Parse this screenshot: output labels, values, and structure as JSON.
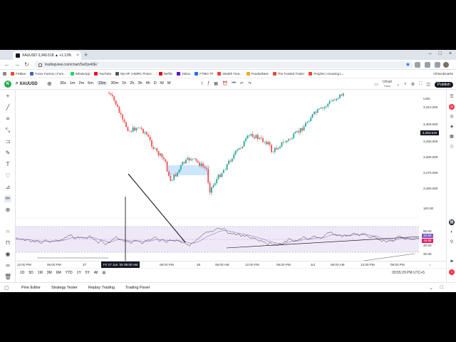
{
  "browser": {
    "tab_title": "XAUUSD 3,340.518 ▲ +1.13%",
    "url": "tradingview.com/chart/SeDjo40E/",
    "bookmarks": [
      {
        "label": "FXBlue",
        "color": "#e8463a"
      },
      {
        "label": "Forex Factory | Fore...",
        "color": "#3a66c4"
      },
      {
        "label": "WhatsApp",
        "color": "#25d366"
      },
      {
        "label": "YouTube",
        "color": "#ff0000"
      },
      {
        "label": "My HP | HMRC Protec...",
        "color": "#555"
      },
      {
        "label": "Netflix",
        "color": "#e50914"
      },
      {
        "label": "Yahoo",
        "color": "#6001d2"
      },
      {
        "label": "FTMO TP",
        "color": "#1f6feb"
      },
      {
        "label": "Wealth Trea...",
        "color": "#e8463a"
      },
      {
        "label": "FundedNext",
        "color": "#f5a623"
      },
      {
        "label": "The Funded Trader",
        "color": "#e8463a"
      },
      {
        "label": "Prophet | Amazing L...",
        "color": "#e8463a"
      }
    ],
    "all_bookmarks": "All Bookmarks"
  },
  "toolbar": {
    "logo": "K",
    "symbol": "XAUUSD",
    "timeframes": [
      "30s",
      "1m",
      "2m",
      "5m",
      "15m",
      "30m",
      "1h",
      "2h",
      "3h",
      "4h",
      "D",
      "W",
      "M"
    ],
    "active_timeframe": "15m",
    "layout_name": "Umair",
    "layout_sub": "Save",
    "publish": "Publish"
  },
  "price_axis": {
    "currency": "USD",
    "labels": [
      "3,310.000",
      "3,300.000",
      "3,290.000",
      "3,280.000",
      "3,270.000",
      "3,260.000"
    ],
    "current_price": "3,294.519",
    "rsi_labels": [
      "100.00",
      "60.00",
      "40.00",
      "30.00",
      "0.00"
    ],
    "rsi_tag_1": "50.89",
    "rsi_tag_2": "44.88"
  },
  "time_axis": {
    "labels": [
      "12:00 PM",
      "06:00 PM",
      "27",
      "06:00 PM",
      "28",
      "06:00 AM",
      "12:00 PM",
      "06:00 PM",
      "Jul",
      "06:00 AM",
      "12:00 PM",
      "06:00 PM"
    ],
    "cursor": "Fri 27 Jun '25   09:00 AM"
  },
  "range_bar": {
    "ranges": [
      "1D",
      "5D",
      "1M",
      "3M",
      "6M",
      "YTD",
      "1Y",
      "5Y",
      "All"
    ],
    "clock": "09:55:29 PM UTC+5"
  },
  "bottom_tabs": [
    "Pine Editor",
    "Strategy Tester",
    "Replay Trading",
    "Trading Panel"
  ],
  "tv_watermark": "17"
}
